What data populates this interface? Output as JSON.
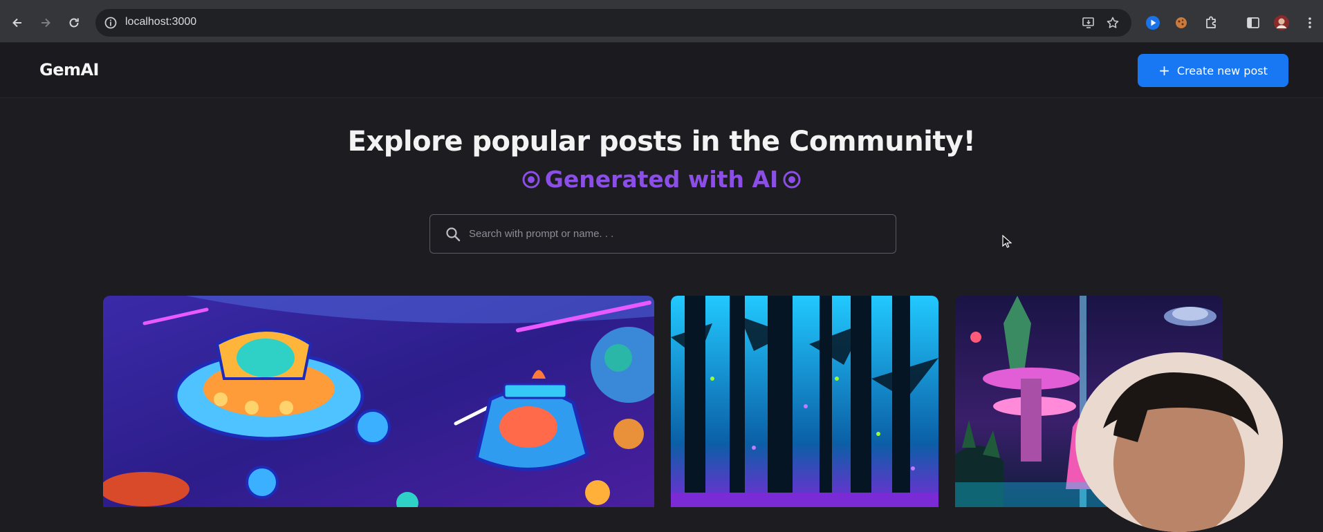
{
  "browser": {
    "url": "localhost:3000"
  },
  "header": {
    "logo": "GemAI",
    "create_button": {
      "icon": "+",
      "label": "Create new post"
    }
  },
  "hero": {
    "title": "Explore popular posts in the Community!",
    "subtitle": "Generated with AI",
    "accent": "#8b4ee6"
  },
  "search": {
    "placeholder": "Search with prompt or name. . ."
  },
  "posts": [
    {
      "image": "space-ships-cartoon"
    },
    {
      "image": "neon-forest"
    },
    {
      "image": "fantasy-city"
    }
  ],
  "colors": {
    "background": "#1c1c21",
    "header_bg": "#1a1a1f",
    "primary": "#1877f2"
  }
}
